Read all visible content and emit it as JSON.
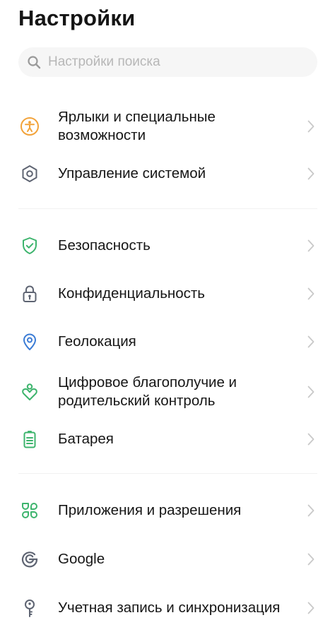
{
  "header": {
    "title": "Настройки"
  },
  "search": {
    "placeholder": "Настройки поиска"
  },
  "colors": {
    "orange": "#F2A33A",
    "gray_icon": "#5E6472",
    "green": "#3DB46D",
    "blue": "#3A7BD5",
    "chevron": "#C9C9C9",
    "divider": "#F1F1F1"
  },
  "sections": [
    {
      "items": [
        {
          "label": "Ярлыки и специальные возможности",
          "icon": "accessibility-icon"
        },
        {
          "label": "Управление системой",
          "icon": "hexagon-settings-icon"
        }
      ]
    },
    {
      "items": [
        {
          "label": "Безопасность",
          "icon": "shield-check-icon"
        },
        {
          "label": "Конфиденциальность",
          "icon": "lock-icon"
        },
        {
          "label": "Геолокация",
          "icon": "location-pin-icon"
        },
        {
          "label": "Цифровое благополучие и родительский контроль",
          "icon": "heart-person-icon"
        },
        {
          "label": "Батарея",
          "icon": "battery-icon"
        }
      ]
    },
    {
      "items": [
        {
          "label": "Приложения и разрешения",
          "icon": "apps-icon"
        },
        {
          "label": "Google",
          "icon": "google-icon"
        },
        {
          "label": "Учетная запись и синхронизация",
          "icon": "key-icon"
        }
      ]
    }
  ]
}
